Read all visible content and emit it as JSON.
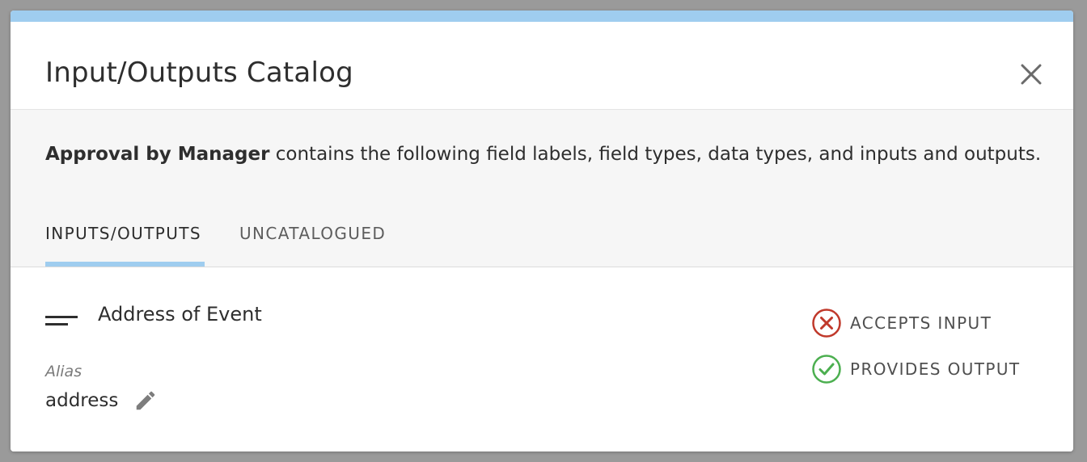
{
  "modal": {
    "title": "Input/Outputs Catalog",
    "close_icon": "close-icon"
  },
  "description": {
    "subject": "Approval by Manager",
    "text": " contains the following field labels, field types, data types, and inputs and outputs."
  },
  "tabs": [
    {
      "label": "INPUTS/OUTPUTS",
      "active": true
    },
    {
      "label": "UNCATALOGUED",
      "active": false
    }
  ],
  "field": {
    "icon": "text-field-icon",
    "name": "Address of Event",
    "alias_label": "Alias",
    "alias_value": "address",
    "edit_icon": "pencil-icon"
  },
  "status": {
    "accepts_input": {
      "label": "ACCEPTS INPUT",
      "enabled": false,
      "icon": "x-circle-icon",
      "color": "#c0392b"
    },
    "provides_output": {
      "label": "PROVIDES OUTPUT",
      "enabled": true,
      "icon": "check-circle-icon",
      "color": "#4caf50"
    }
  },
  "colors": {
    "accent": "#9fcdef",
    "backdrop": "#9a9a9a",
    "section_bg": "#f6f6f6"
  }
}
